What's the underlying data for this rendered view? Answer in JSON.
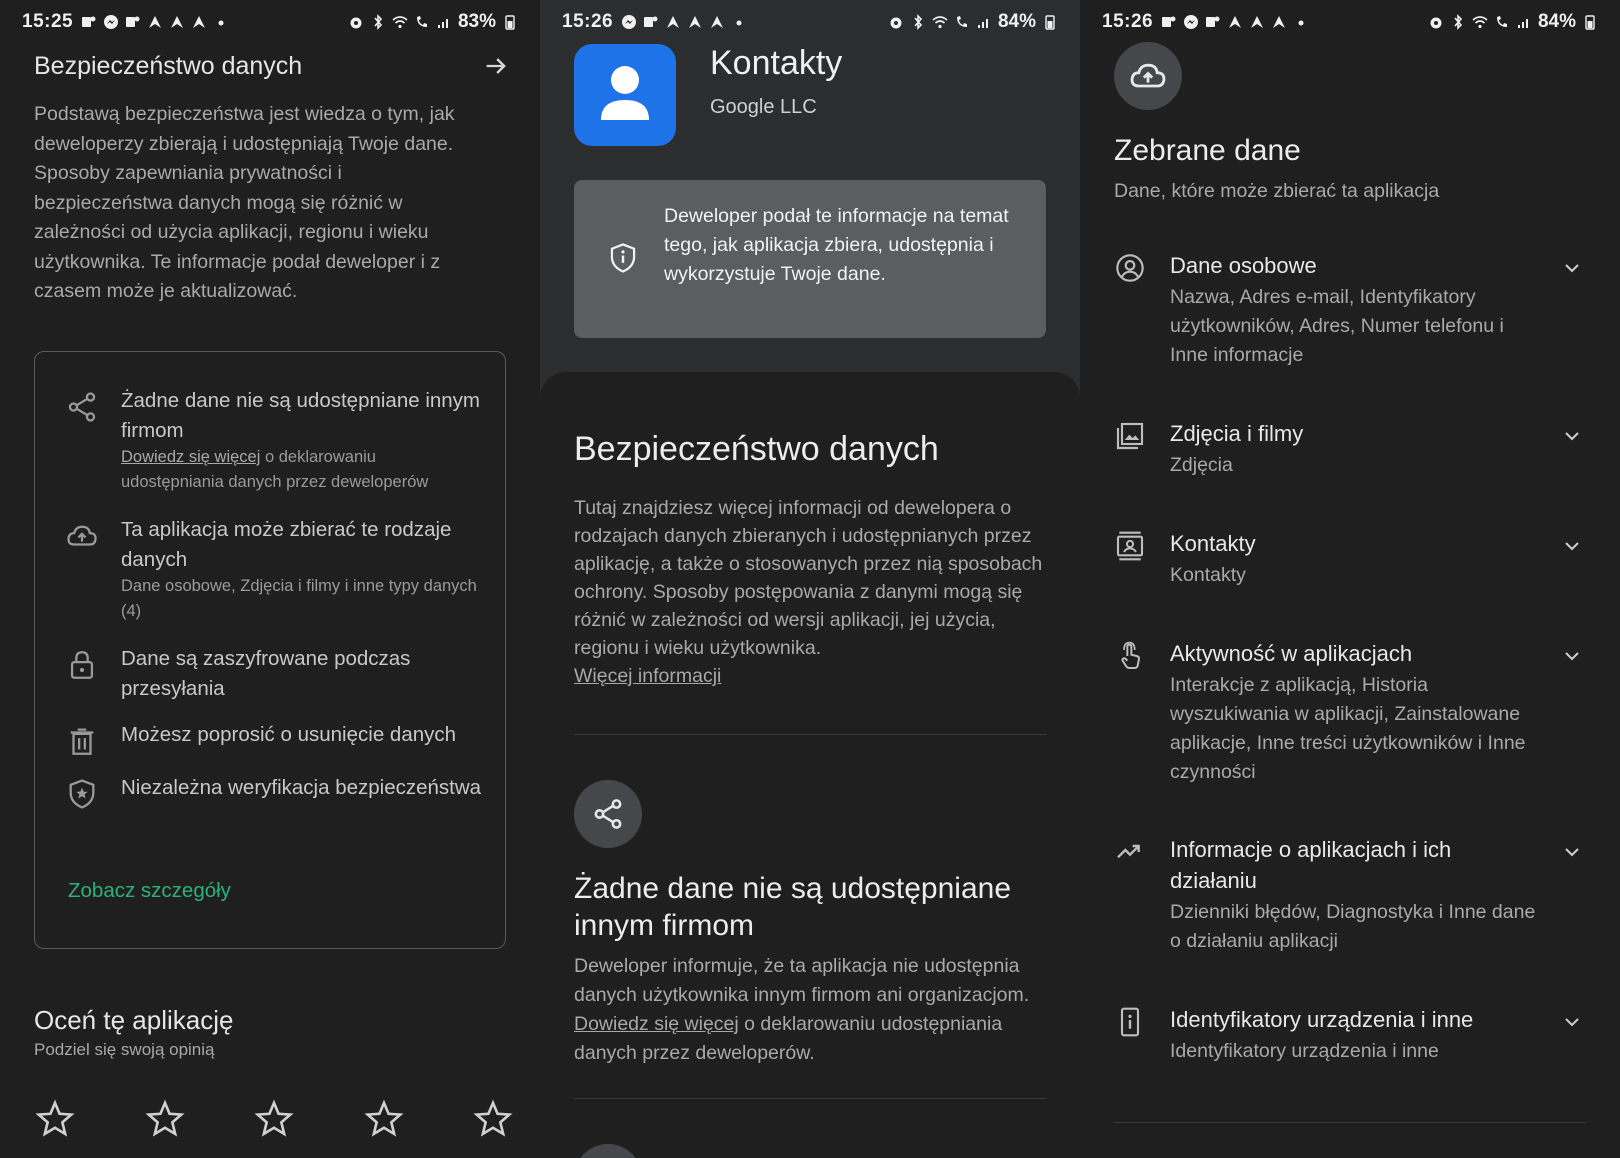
{
  "panel1": {
    "status": {
      "time": "15:25",
      "battery": "83%"
    },
    "header_title": "Bezpieczeństwo danych",
    "description": "Podstawą bezpieczeństwa jest wiedza o tym, jak deweloperzy zbierają i udostępniają Twoje dane. Sposoby zapewniania prywatności i bezpieczeństwa danych mogą się różnić w zależności od użycia aplikacji, regionu i wieku użytkownika. Te informacje podał deweloper i z czasem może je aktualizować.",
    "card": {
      "row1_main": "Żadne dane nie są udostępniane innym firmom",
      "row1_link": "Dowiedz się więcej",
      "row1_sub_rest": " o deklarowaniu udostępniania danych przez deweloperów",
      "row2_main": "Ta aplikacja może zbierać te rodzaje danych",
      "row2_sub": "Dane osobowe, Zdjęcia i filmy i inne typy danych (4)",
      "row3_main": "Dane są zaszyfrowane podczas przesyłania",
      "row4_main": "Możesz poprosić o usunięcie danych",
      "row5_main": "Niezależna weryfikacja bezpieczeństwa",
      "see_details": "Zobacz szczegóły"
    },
    "rate_title": "Oceń tę aplikację",
    "rate_sub": "Podziel się swoją opinią"
  },
  "panel2": {
    "status": {
      "time": "15:26",
      "battery": "84%"
    },
    "app_name": "Kontakty",
    "developer": "Google LLC",
    "banner": "Deweloper podał te informacje na temat tego, jak aplikacja zbiera, udostępnia i wykorzystuje Twoje dane.",
    "section_title": "Bezpieczeństwo danych",
    "section_desc": "Tutaj znajdziesz więcej informacji od dewelopera o rodzajach danych zbieranych i udostępnianych przez aplikację, a także o stosowanych przez nią sposobach ochrony. Sposoby postępowania z danymi mogą się różnić w zależności od wersji aplikacji, jej użycia, regionu i wieku użytkownika.",
    "more_info": "Więcej informacji",
    "sharing_title": "Żadne dane nie są udostępniane innym firmom",
    "sharing_desc": "Deweloper informuje, że ta aplikacja nie udostępnia danych użytkownika innym firmom ani organizacjom. ",
    "sharing_link": "Dowiedz się więcej",
    "sharing_desc_rest": " o deklarowaniu udostępniania danych przez deweloperów."
  },
  "panel3": {
    "status": {
      "time": "15:26",
      "battery": "84%"
    },
    "title": "Zebrane dane",
    "subtitle": "Dane, które może zbierać ta aplikacja",
    "categories": [
      {
        "name": "Dane osobowe",
        "items": "Nazwa, Adres e-mail, Identyfikatory użytkowników, Adres, Numer telefonu i Inne informacje",
        "icon": "account-circle-icon"
      },
      {
        "name": "Zdjęcia i filmy",
        "items": "Zdjęcia",
        "icon": "photo-library-icon"
      },
      {
        "name": "Kontakty",
        "items": "Kontakty",
        "icon": "contacts-icon"
      },
      {
        "name": "Aktywność w aplikacjach",
        "items": "Interakcje z aplikacją, Historia wyszukiwania w aplikacji, Zainstalowane aplikacje, Inne treści użytkowników i Inne czynności",
        "icon": "touch-icon"
      },
      {
        "name": "Informacje o aplikacjach i ich działaniu",
        "items": "Dzienniki błędów, Diagnostyka i Inne dane o działaniu aplikacji",
        "icon": "trending-icon"
      },
      {
        "name": "Identyfikatory urządzenia i inne",
        "items": "Identyfikatory urządzenia i inne",
        "icon": "device-info-icon"
      }
    ]
  }
}
